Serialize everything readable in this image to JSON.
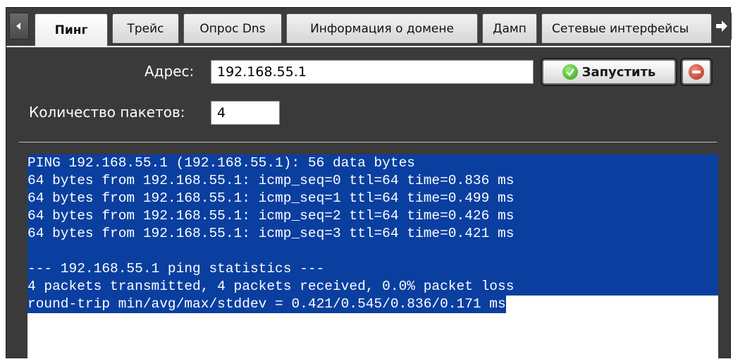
{
  "tabs": [
    {
      "label": "Пинг",
      "active": true
    },
    {
      "label": "Трейс",
      "active": false
    },
    {
      "label": "Опрос Dns",
      "active": false
    },
    {
      "label": "Информация о домене",
      "active": false
    },
    {
      "label": "Дамп",
      "active": false
    },
    {
      "label": "Сетевые интерфейсы",
      "active": false
    }
  ],
  "nav": {
    "left_icon": "arrow-left-icon",
    "right_icon": "arrow-right-icon"
  },
  "form": {
    "address_label": "Адрес:",
    "address_value": "192.168.55.1",
    "packets_label": "Количество пакетов:",
    "packets_value": "4",
    "run_label": "Запустить",
    "run_icon": "check-circle-icon",
    "stop_icon": "stop-circle-icon"
  },
  "output": {
    "lines": [
      "PING 192.168.55.1 (192.168.55.1): 56 data bytes",
      "64 bytes from 192.168.55.1: icmp_seq=0 ttl=64 time=0.836 ms",
      "64 bytes from 192.168.55.1: icmp_seq=1 ttl=64 time=0.499 ms",
      "64 bytes from 192.168.55.1: icmp_seq=2 ttl=64 time=0.426 ms",
      "64 bytes from 192.168.55.1: icmp_seq=3 ttl=64 time=0.421 ms",
      "",
      "--- 192.168.55.1 ping statistics ---",
      "4 packets transmitted, 4 packets received, 0.0% packet loss",
      "round-trip min/avg/max/stddev = 0.421/0.545/0.836/0.171 ms"
    ]
  },
  "colors": {
    "selection": "#0a3fa0",
    "panel": "#3a3a3a",
    "run_icon": "#2e9a16",
    "stop_icon": "#b22a1a"
  }
}
